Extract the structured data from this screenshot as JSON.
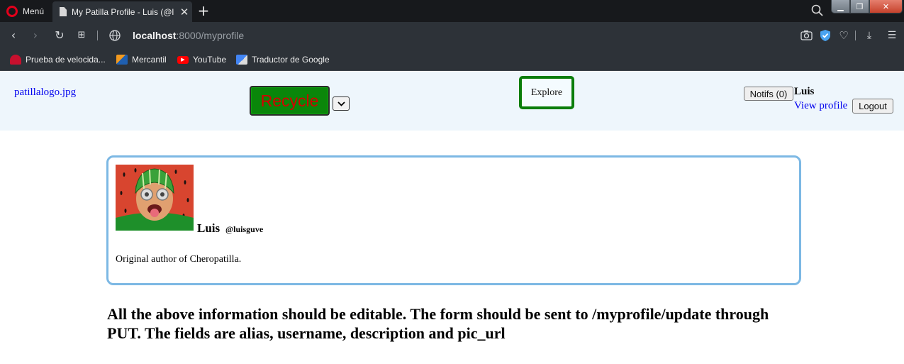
{
  "browser": {
    "menu_label": "Menú",
    "tab_title": "My Patilla Profile - Luis (@l",
    "url_host": "localhost",
    "url_rest": ":8000/myprofile",
    "bookmarks": [
      {
        "label": "Prueba de velocida...",
        "icon": "speedometer-icon",
        "color": "#c8102e"
      },
      {
        "label": "Mercantil",
        "icon": "mercantil-icon",
        "color": "#1f5fb0"
      },
      {
        "label": "YouTube",
        "icon": "youtube-icon",
        "color": "#ff0000"
      },
      {
        "label": "Traductor de Google",
        "icon": "google-translate-icon",
        "color": "#4285f4"
      }
    ]
  },
  "header": {
    "logo_alt": "patillalogo.jpg",
    "recycle_label": "Recycle",
    "explore_label": "Explore",
    "notifs_label": "Notifs (0)",
    "user_name": "Luis",
    "view_profile_label": "View profile",
    "logout_label": "Logout"
  },
  "profile": {
    "alias": "Luis",
    "username": "@luisguve",
    "description": "Original author of Cheropatilla."
  },
  "note": "All the above information should be editable. The form should be sent to /myprofile/update through PUT. The fields are alias, username, description and pic_url",
  "colors": {
    "header_bg": "#eef6fc",
    "recycle_bg": "#0a860a",
    "recycle_text": "#d40000",
    "explore_border": "#0a7d0a",
    "card_border": "#7cb8e4",
    "link": "#0000ee"
  }
}
